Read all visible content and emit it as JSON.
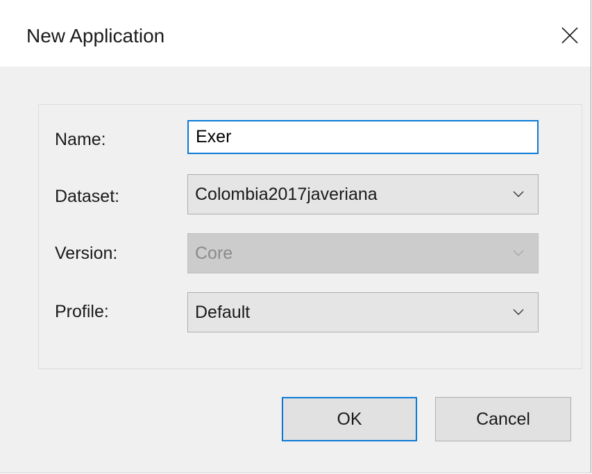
{
  "dialog": {
    "title": "New Application",
    "close_icon": "close-icon"
  },
  "form": {
    "name": {
      "label": "Name:",
      "value": "Exer"
    },
    "dataset": {
      "label": "Dataset:",
      "value": "Colombia2017javeriana"
    },
    "version": {
      "label": "Version:",
      "value": "Core",
      "disabled": true
    },
    "profile": {
      "label": "Profile:",
      "value": "Default"
    }
  },
  "buttons": {
    "ok_label": "OK",
    "cancel_label": "Cancel"
  },
  "colors": {
    "focus_border": "#0a78d7",
    "dialog_bg": "#f0f0f0",
    "disabled_bg": "#cccccc",
    "disabled_text": "#8a8a8a"
  }
}
